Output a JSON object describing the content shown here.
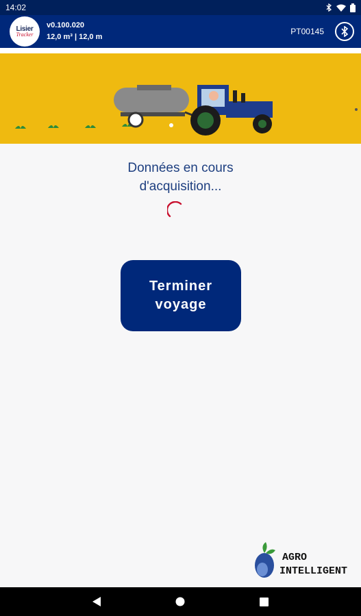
{
  "status_bar": {
    "time": "14:02",
    "icons": [
      "bluetooth-icon",
      "wifi-icon",
      "battery-icon"
    ]
  },
  "header": {
    "logo_text": "Lisier",
    "logo_subtext": "Tracker",
    "version": "v0.100.020",
    "capacity": "12,0 m³ | 12,0 m",
    "device_id": "PT00145",
    "bluetooth_icon": "bluetooth-icon"
  },
  "main": {
    "message_line1": "Données en cours",
    "message_line2": "d'acquisition...",
    "finish_button_line1": "Terminer",
    "finish_button_line2": "voyage"
  },
  "footer_brand": {
    "line1": "AGRO",
    "line2": "INTELLIGENT"
  },
  "nav": [
    "back-icon",
    "home-icon",
    "recents-icon"
  ],
  "colors": {
    "primary": "#00287a",
    "banner": "#efba10",
    "accent": "#c8102e",
    "text": "#1e3f80"
  }
}
